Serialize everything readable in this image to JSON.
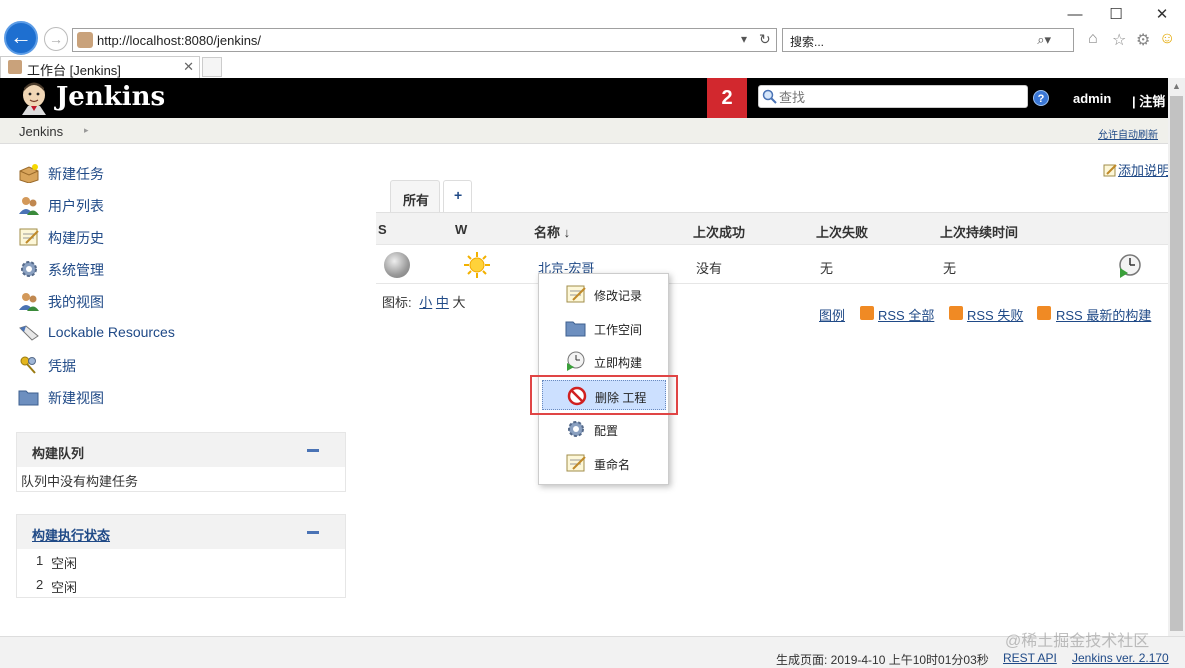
{
  "browser": {
    "url": "http://localhost:8080/jenkins/",
    "search_placeholder": "搜索...",
    "tab_title": "工作台 [Jenkins]",
    "win_minimize": "—",
    "win_maximize": "☐",
    "win_close": "✕",
    "back_glyph": "←",
    "forward_glyph": "→",
    "refresh_glyph": "↻",
    "dropdown_glyph": "▾",
    "search_glyph": "⌕▾",
    "home_glyph": "⌂",
    "star_glyph": "☆",
    "gear_glyph": "⚙",
    "smiley_glyph": "☺",
    "tab_close": "✕"
  },
  "header": {
    "title": "Jenkins",
    "badge_count": "2",
    "search_placeholder": "查找",
    "help": "?",
    "user": "admin",
    "logout": "| 注销"
  },
  "breadcrumb": {
    "home": "Jenkins",
    "arrow": "▸",
    "auto_refresh": "允许自动刷新"
  },
  "sidebar": {
    "items": [
      {
        "label": "新建任务",
        "icon": "new-package-icon"
      },
      {
        "label": "用户列表",
        "icon": "users-icon"
      },
      {
        "label": "构建历史",
        "icon": "notepad-icon"
      },
      {
        "label": "系统管理",
        "icon": "gear-icon"
      },
      {
        "label": "我的视图",
        "icon": "users-icon"
      },
      {
        "label": "Lockable Resources",
        "icon": "usb-icon"
      },
      {
        "label": "凭据",
        "icon": "keys-icon"
      },
      {
        "label": "新建视图",
        "icon": "folder-icon"
      }
    ],
    "queue": {
      "title": "构建队列",
      "empty": "队列中没有构建任务"
    },
    "executors": {
      "title": "构建执行状态",
      "rows": [
        {
          "num": "1",
          "state": "空闲"
        },
        {
          "num": "2",
          "state": "空闲"
        }
      ]
    }
  },
  "main": {
    "add_description": "添加说明",
    "tabs": [
      {
        "label": "所有"
      },
      {
        "label": "+"
      }
    ],
    "table": {
      "headers": {
        "s": "S",
        "w": "W",
        "name": "名称 ↓",
        "last_success": "上次成功",
        "last_failure": "上次失败",
        "last_duration": "上次持续时间"
      },
      "rows": [
        {
          "name": "北京-宏哥",
          "last_success": "没有",
          "last_failure": "无",
          "last_duration": "无"
        }
      ]
    },
    "icon_size": {
      "label": "图标:",
      "small": "小",
      "medium": "中",
      "large": "大"
    },
    "links": {
      "legend": "图例",
      "rss_all": "RSS 全部",
      "rss_failed": "RSS 失败",
      "rss_latest": "RSS 最新的构建"
    }
  },
  "context_menu": {
    "items": [
      {
        "label": "修改记录",
        "icon": "notepad-icon"
      },
      {
        "label": "工作空间",
        "icon": "folder-icon"
      },
      {
        "label": "立即构建",
        "icon": "clock-play-icon"
      },
      {
        "label": "删除 工程",
        "icon": "no-entry-icon",
        "selected": true
      },
      {
        "label": "配置",
        "icon": "gear-icon"
      },
      {
        "label": "重命名",
        "icon": "notepad-icon"
      }
    ]
  },
  "footer": {
    "generated": "生成页面: 2019-4-10 上午10时01分03秒",
    "rest_api": "REST API",
    "version": "Jenkins ver. 2.170"
  },
  "watermark": "@稀土掘金技术社区",
  "colors": {
    "header_bg": "#000000",
    "badge": "#d2282e",
    "link": "#204a87",
    "highlight": "#e04545",
    "selected_bg": "#cce0ff"
  }
}
